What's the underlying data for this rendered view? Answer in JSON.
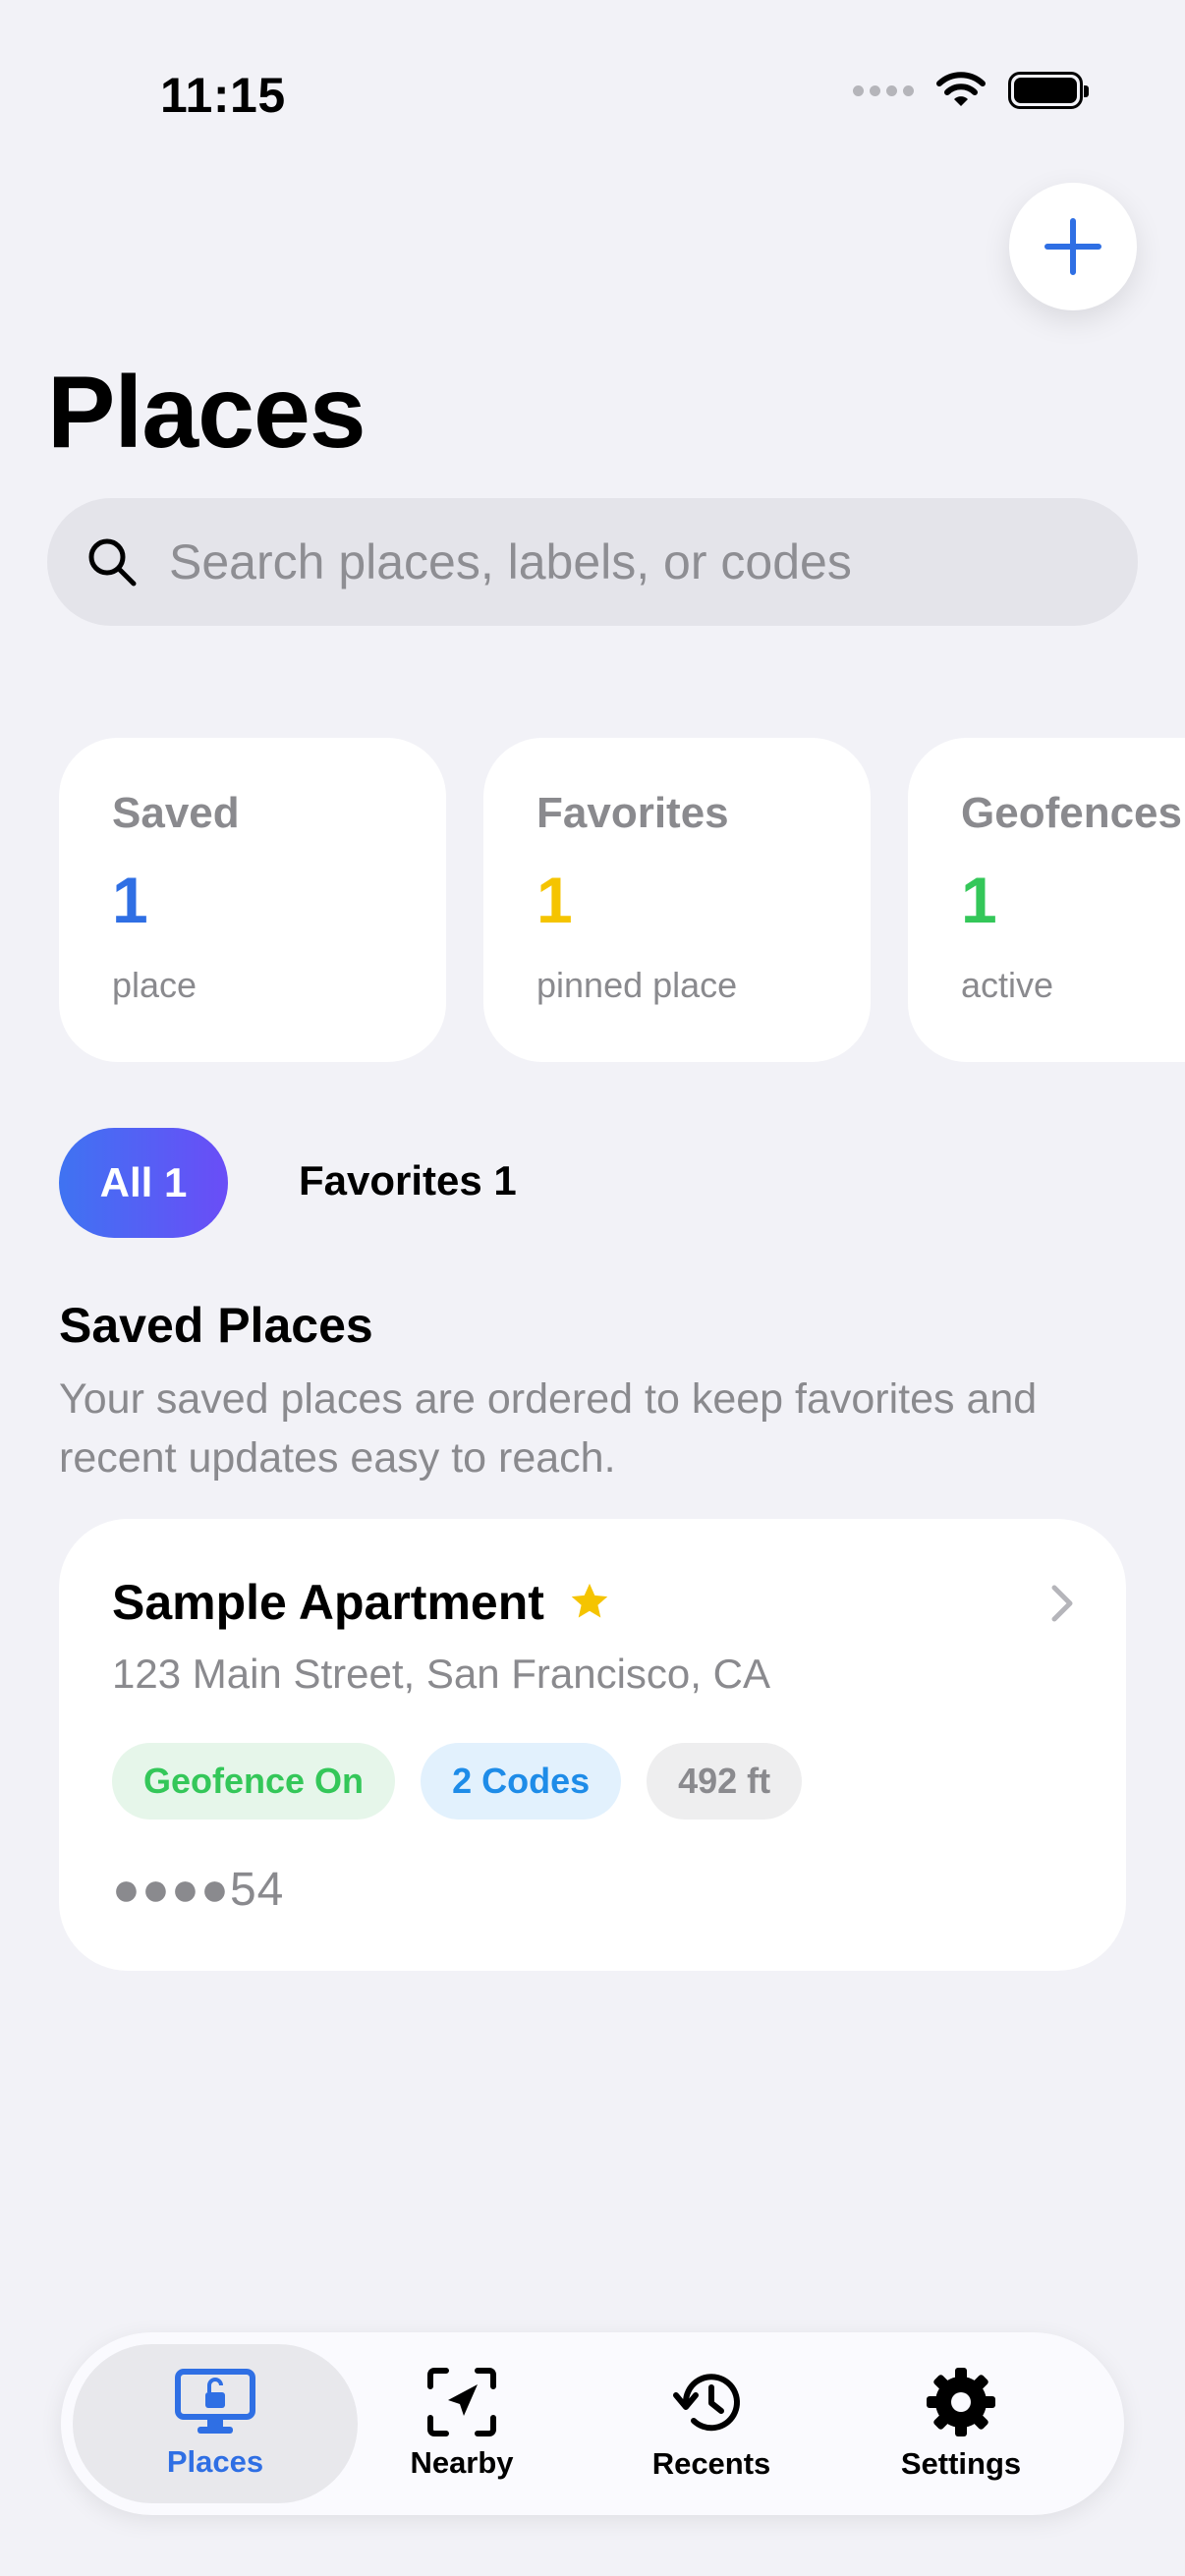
{
  "status_bar": {
    "time": "11:15"
  },
  "header": {
    "title": "Places",
    "add_button_icon": "plus-icon"
  },
  "search": {
    "placeholder": "Search places, labels, or codes",
    "value": ""
  },
  "stats": [
    {
      "title": "Saved",
      "value": "1",
      "subtitle": "place",
      "color": "#2F6FE4"
    },
    {
      "title": "Favorites",
      "value": "1",
      "subtitle": "pinned place",
      "color": "#F5C400"
    },
    {
      "title": "Geofences",
      "value": "1",
      "subtitle": "active",
      "color": "#34C759"
    }
  ],
  "filters": {
    "all_label": "All 1",
    "favorites_label": "Favorites 1"
  },
  "section": {
    "title": "Saved Places",
    "subtitle": "Your saved places are ordered to keep favorites and recent updates easy to reach."
  },
  "places": [
    {
      "name": "Sample Apartment",
      "favorite": true,
      "address": "123 Main Street, San Francisco, CA",
      "tags": [
        "Geofence On",
        "2 Codes",
        "492 ft"
      ],
      "code_masked": "●●●●54"
    }
  ],
  "tabbar": {
    "items": [
      {
        "label": "Places",
        "icon": "monitor-lock-icon",
        "active": true
      },
      {
        "label": "Nearby",
        "icon": "location-arrow-icon",
        "active": false
      },
      {
        "label": "Recents",
        "icon": "clock-history-icon",
        "active": false
      },
      {
        "label": "Settings",
        "icon": "gear-icon",
        "active": false
      }
    ]
  },
  "colors": {
    "accent": "#2F6FE4",
    "background": "#F2F2F7",
    "favorite_star": "#F5C400"
  }
}
